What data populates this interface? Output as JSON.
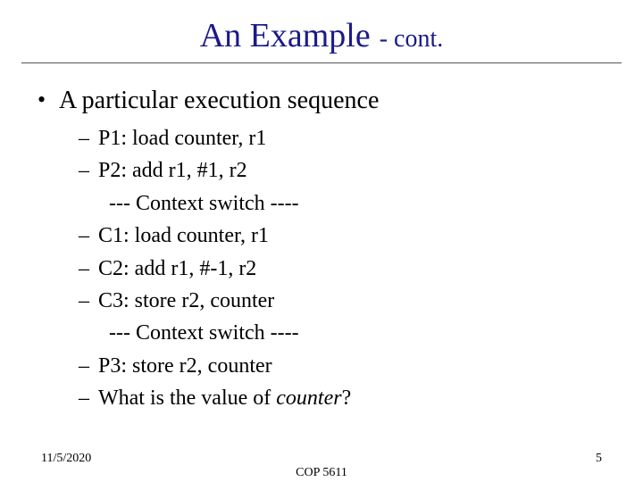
{
  "title": {
    "main": "An Example",
    "sub": "- cont."
  },
  "bullet": "A particular execution sequence",
  "items": [
    {
      "dash": true,
      "text": "P1:  load counter, r1"
    },
    {
      "dash": true,
      "text": "P2:  add  r1, #1, r2"
    },
    {
      "dash": false,
      "text": "--- Context switch ----"
    },
    {
      "dash": true,
      "text": "C1: load counter, r1"
    },
    {
      "dash": true,
      "text": "C2: add r1, #-1, r2"
    },
    {
      "dash": true,
      "text": "C3: store r2, counter"
    },
    {
      "dash": false,
      "text": "--- Context switch ----"
    },
    {
      "dash": true,
      "text": "P3:  store r2, counter"
    }
  ],
  "question": {
    "prefix": "What is the value of ",
    "ital": "counter",
    "suffix": "?"
  },
  "footer": {
    "date": "11/5/2020",
    "course": "COP 5611",
    "page": "5"
  }
}
